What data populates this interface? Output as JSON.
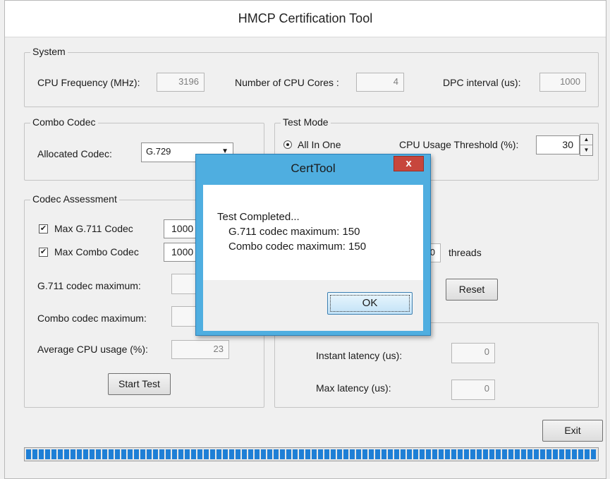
{
  "window": {
    "title": "HMCP Certification Tool"
  },
  "system": {
    "legend": "System",
    "cpu_freq_label": "CPU Frequency (MHz):",
    "cpu_freq_value": "3196",
    "cpu_cores_label": "Number of CPU Cores :",
    "cpu_cores_value": "4",
    "dpc_label": "DPC interval (us):",
    "dpc_value": "1000"
  },
  "combo_codec": {
    "legend": "Combo Codec",
    "allocated_label": "Allocated Codec:",
    "allocated_value": "G.729",
    "dropdown_arrow": "▼"
  },
  "test_mode": {
    "legend": "Test Mode",
    "radio_all_in_one": "All In One",
    "cpu_threshold_label": "CPU Usage Threshold (%):",
    "cpu_threshold_value": "30",
    "threads_label": "threads",
    "threads_value": "0",
    "reset_label": "Reset"
  },
  "codec_assessment": {
    "legend": "Codec Assessment",
    "max_g711_label": "Max G.711 Codec",
    "max_g711_checked": true,
    "max_g711_value": "1000",
    "max_combo_label": "Max Combo Codec",
    "max_combo_checked": true,
    "max_combo_value": "1000",
    "g711_max_label": "G.711 codec maximum:",
    "combo_max_label": "Combo codec maximum:",
    "avg_cpu_label": "Average CPU usage (%):",
    "avg_cpu_value": "23",
    "start_test_label": "Start Test"
  },
  "latency": {
    "instant_label": "Instant latency (us):",
    "instant_value": "0",
    "max_label": "Max latency (us):",
    "max_value": "0"
  },
  "exit_label": "Exit",
  "progress": {
    "value": 1.0
  },
  "dialog": {
    "title": "CertTool",
    "close_glyph": "x",
    "line1": "Test Completed...",
    "line2": "G.711 codec maximum: 150",
    "line3": "Combo codec maximum: 150",
    "ok_label": "OK"
  },
  "colors": {
    "progress": "#1e7fd6",
    "dialog_frame": "#4faee0",
    "close_button": "#c7463c"
  }
}
